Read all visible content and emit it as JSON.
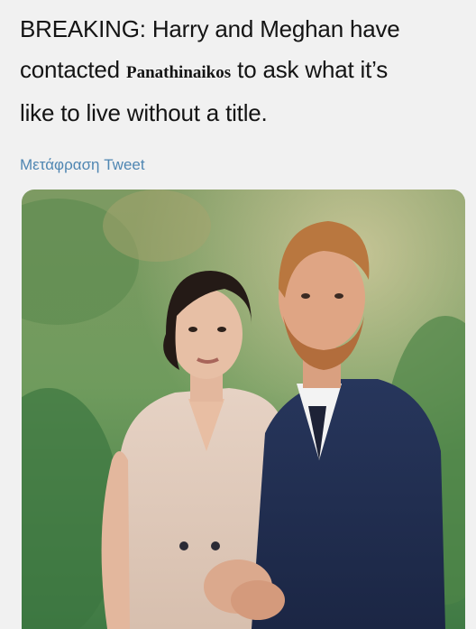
{
  "tweet": {
    "line1": "BREAKING: Harry and Meghan have",
    "line2_pre": "contacted",
    "brand": "Panathinaikos",
    "line2_post": "to ask what it’s",
    "line3": "like to live without a title."
  },
  "translate_link": "Μετάφραση Tweet",
  "colors": {
    "background": "#f1f1f1",
    "text": "#141414",
    "link": "#4f86b2"
  },
  "media": {
    "icon": "photo-icon"
  }
}
